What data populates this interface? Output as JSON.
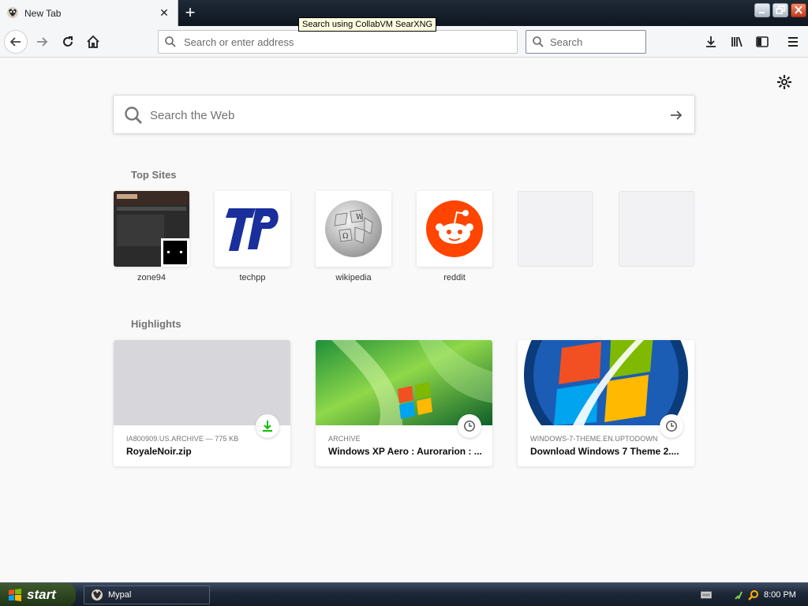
{
  "browser": {
    "tab": {
      "title": "New Tab",
      "close_glyph": "✕",
      "favicon": "firefox-icon"
    },
    "new_tab_glyph": "+",
    "tooltip": "Search using CollabVM SearXNG",
    "urlbar": {
      "placeholder": "Search or enter address"
    },
    "searchbar": {
      "placeholder": "Search"
    },
    "toolbar_icons": [
      "back-icon",
      "forward-icon",
      "reload-icon",
      "home-icon",
      "download-icon",
      "library-icon",
      "sidebar-icon",
      "menu-icon"
    ]
  },
  "newtab": {
    "web_search": {
      "placeholder": "Search the Web"
    },
    "top_sites_title": "Top Sites",
    "top_sites": [
      {
        "label": "zone94"
      },
      {
        "label": "techpp"
      },
      {
        "label": "wikipedia"
      },
      {
        "label": "reddit"
      },
      {
        "label": ""
      },
      {
        "label": ""
      }
    ],
    "highlights_title": "Highlights",
    "highlights": [
      {
        "source": "IA800909.US.ARCHIVE — 775 KB",
        "title": "RoyaleNoir.zip",
        "badge": "download-icon"
      },
      {
        "source": "ARCHIVE",
        "title": "Windows XP Aero : Aurorarion : ...",
        "badge": "clock-icon"
      },
      {
        "source": "WINDOWS-7-THEME.EN.UPTODOWN",
        "title": "Download Windows 7 Theme 2....",
        "badge": "clock-icon"
      }
    ]
  },
  "taskbar": {
    "start_label": "start",
    "task_label": "Mypal",
    "clock": "8:00 PM"
  },
  "colors": {
    "reddit": "#ff4500",
    "techpp": "#1a2f9c",
    "download_badge": "#12bc00"
  }
}
